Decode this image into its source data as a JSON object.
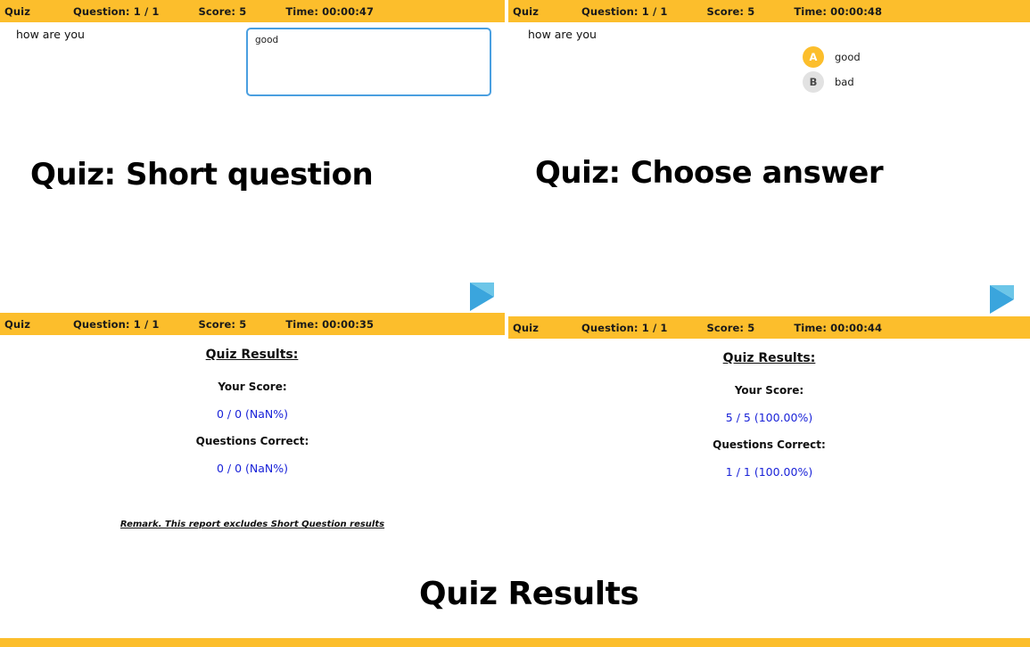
{
  "panels": {
    "short_question": {
      "topbar": {
        "title": "Quiz",
        "question": "Question: 1 / 1",
        "score": "Score: 5",
        "time": "Time: 00:00:47"
      },
      "question_text": "how are you",
      "answer_value": "good",
      "answer_placeholder": ""
    },
    "choose_answer": {
      "topbar": {
        "title": "Quiz",
        "question": "Question: 1 / 1",
        "score": "Score: 5",
        "time": "Time: 00:00:48"
      },
      "question_text": "how are you",
      "options": [
        {
          "key": "A",
          "label": "good",
          "selected": true
        },
        {
          "key": "B",
          "label": "bad",
          "selected": false
        }
      ]
    },
    "results_left": {
      "topbar": {
        "title": "Quiz",
        "question": "Question: 1 / 1",
        "score": "Score: 5",
        "time": "Time: 00:00:35"
      },
      "heading": "Quiz Results:",
      "score_label": "Your Score:",
      "score_value": "0 / 0 (NaN%)",
      "correct_label": "Questions Correct:",
      "correct_value": "0 / 0 (NaN%)",
      "remark": "Remark. This report excludes Short Question results"
    },
    "results_right": {
      "topbar": {
        "title": "Quiz",
        "question": "Question: 1 / 1",
        "score": "Score: 5",
        "time": "Time: 00:00:44"
      },
      "heading": "Quiz Results:",
      "score_label": "Your Score:",
      "score_value": "5 / 5 (100.00%)",
      "correct_label": "Questions Correct:",
      "correct_value": "1 / 1 (100.00%)"
    }
  },
  "captions": {
    "short_question": "Quiz: Short question",
    "choose_answer": "Quiz: Choose answer",
    "results": "Quiz Results"
  },
  "colors": {
    "bar": "#fcbe2c",
    "selected_option": "#fcbe2c",
    "unselected_option": "#e2e2e2",
    "arrow": "#3aa5dd",
    "value_text": "#1a23d8",
    "textarea_border": "#4a9fe0"
  }
}
